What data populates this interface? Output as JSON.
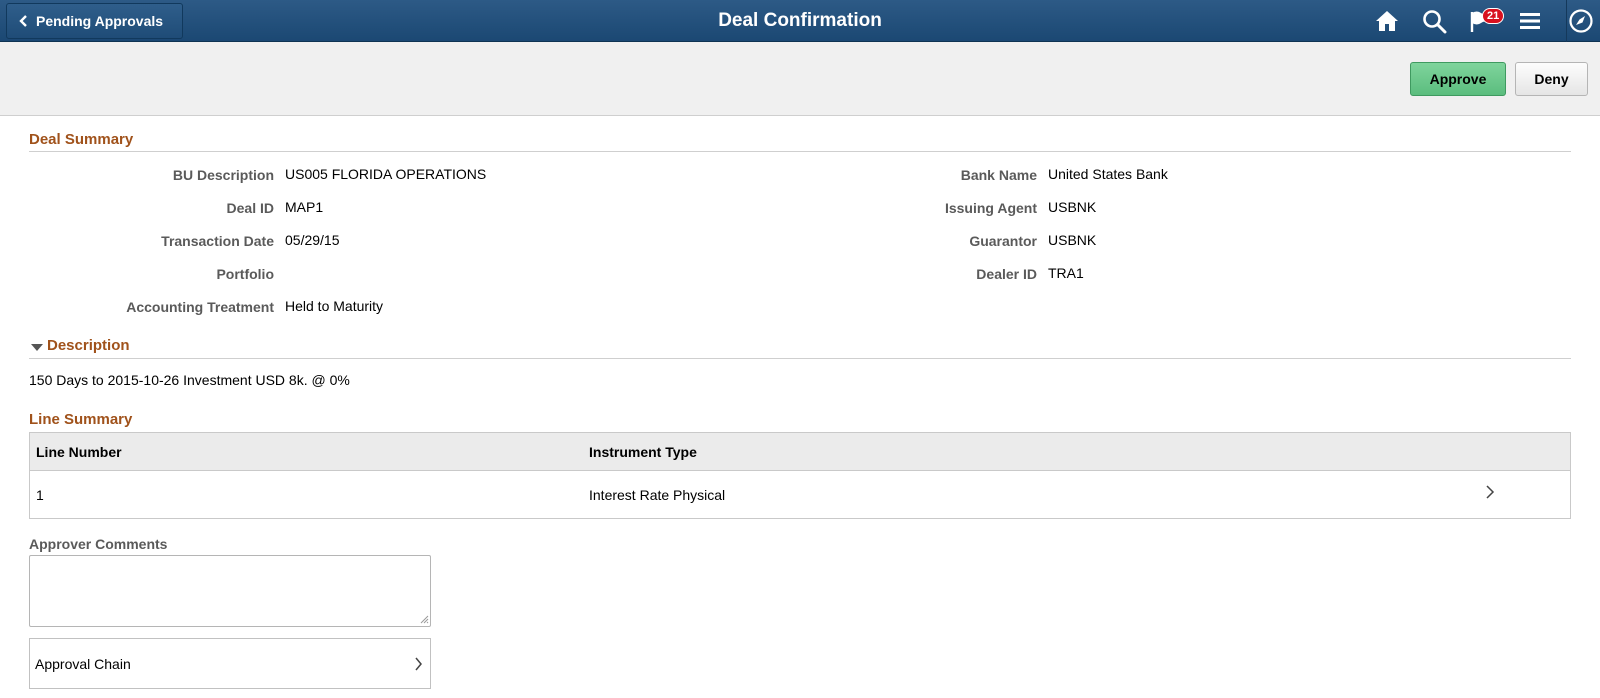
{
  "header": {
    "back_label": "Pending Approvals",
    "title": "Deal Confirmation",
    "notification_count": "21",
    "icons": [
      "home-icon",
      "search-icon",
      "notification-flag-icon",
      "menu-icon",
      "navigator-compass-icon"
    ]
  },
  "actions": {
    "approve_label": "Approve",
    "deny_label": "Deny"
  },
  "deal_summary": {
    "title": "Deal Summary",
    "left_fields": [
      {
        "label": "BU Description",
        "value": "US005 FLORIDA OPERATIONS"
      },
      {
        "label": "Deal ID",
        "value": "MAP1"
      },
      {
        "label": "Transaction Date",
        "value": "05/29/15"
      },
      {
        "label": "Portfolio",
        "value": ""
      },
      {
        "label": "Accounting Treatment",
        "value": "Held to Maturity"
      }
    ],
    "right_fields": [
      {
        "label": "Bank Name",
        "value": "United States Bank"
      },
      {
        "label": "Issuing Agent",
        "value": "USBNK"
      },
      {
        "label": "Guarantor",
        "value": "USBNK"
      },
      {
        "label": "Dealer ID",
        "value": "TRA1"
      }
    ]
  },
  "description": {
    "title": "Description",
    "text": "150 Days to 2015-10-26 Investment USD 8k. @ 0%"
  },
  "line_summary": {
    "title": "Line Summary",
    "columns": [
      "Line Number",
      "Instrument Type"
    ],
    "rows": [
      {
        "line_number": "1",
        "instrument_type": "Interest Rate Physical"
      }
    ]
  },
  "comments": {
    "label": "Approver Comments",
    "value": ""
  },
  "approval_chain": {
    "label": "Approval Chain"
  },
  "colors": {
    "header_bg": "#1f4c77",
    "section_title": "#a0521b",
    "approve_bg": "#5bbd7e",
    "badge_bg": "#d8101e"
  }
}
